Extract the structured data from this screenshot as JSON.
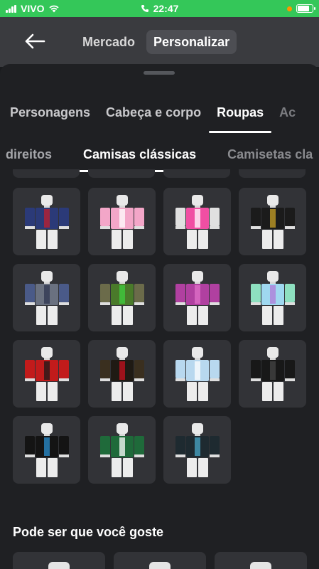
{
  "status_bar": {
    "carrier": "VIVO",
    "time": "22:47",
    "bg_color": "#34c759",
    "indicator_color": "#ff9500",
    "battery_level": 0.8
  },
  "header": {
    "back_icon": "arrow-left-icon",
    "tabs": [
      {
        "label": "Mercado",
        "active": false
      },
      {
        "label": "Personalizar",
        "active": true
      }
    ]
  },
  "category_tabs": [
    {
      "label": "Personagens",
      "active": false
    },
    {
      "label": "Cabeça e corpo",
      "active": false
    },
    {
      "label": "Roupas",
      "active": true
    },
    {
      "label": "Ac",
      "active": false
    }
  ],
  "sub_tabs": [
    {
      "label": "direitos",
      "active": false
    },
    {
      "label": "Camisas clássicas",
      "active": true
    },
    {
      "label": "Camisetas cla",
      "active": false
    }
  ],
  "items": [
    {
      "name": "navy-red-shirt",
      "torso": "#2b3a78",
      "accent": "#c21f2e",
      "arms": "#2b3a78"
    },
    {
      "name": "pink-shirt",
      "torso": "#f3a6c8",
      "accent": "#ffffff",
      "arms": "#f3a6c8"
    },
    {
      "name": "hot-pink-shirt",
      "torso": "#f04fa3",
      "accent": "#ffffff",
      "arms": "#e0e0e0"
    },
    {
      "name": "black-gold-shirt",
      "torso": "#1b1b1b",
      "accent": "#c9a227",
      "arms": "#1b1b1b"
    },
    {
      "name": "gray-blue-shirt",
      "torso": "#6a7180",
      "accent": "#2f3550",
      "arms": "#4a5a88"
    },
    {
      "name": "green-army-shirt",
      "torso": "#4a7a2a",
      "accent": "#3fcf3f",
      "arms": "#6b6b4a"
    },
    {
      "name": "magenta-shirt",
      "torso": "#b040a0",
      "accent": "#e070c8",
      "arms": "#b040a0"
    },
    {
      "name": "pastel-rainbow-shirt",
      "torso": "#9fd8f0",
      "accent": "#b07ad8",
      "arms": "#8ee0c0"
    },
    {
      "name": "red-jersey-shirt",
      "torso": "#c21b1b",
      "accent": "#1b1b1b",
      "arms": "#c21b1b"
    },
    {
      "name": "black-supreme-shirt",
      "torso": "#1f1a14",
      "accent": "#c8101e",
      "arms": "#3a2f1f"
    },
    {
      "name": "light-blue-shirt",
      "torso": "#b8d8ef",
      "accent": "#ffffff",
      "arms": "#b8d8ef"
    },
    {
      "name": "black-shirt",
      "torso": "#181818",
      "accent": "#444444",
      "arms": "#181818"
    },
    {
      "name": "black-blue-shirt",
      "torso": "#141414",
      "accent": "#2a8fd0",
      "arms": "#141414"
    },
    {
      "name": "green-white-shirt",
      "torso": "#1f6a3a",
      "accent": "#ffffff",
      "arms": "#1f6a3a"
    },
    {
      "name": "dark-teal-shirt",
      "torso": "#1e2a30",
      "accent": "#4aa8c8",
      "arms": "#1e2a30"
    }
  ],
  "recommendations": {
    "title": "Pode ser que você goste"
  }
}
